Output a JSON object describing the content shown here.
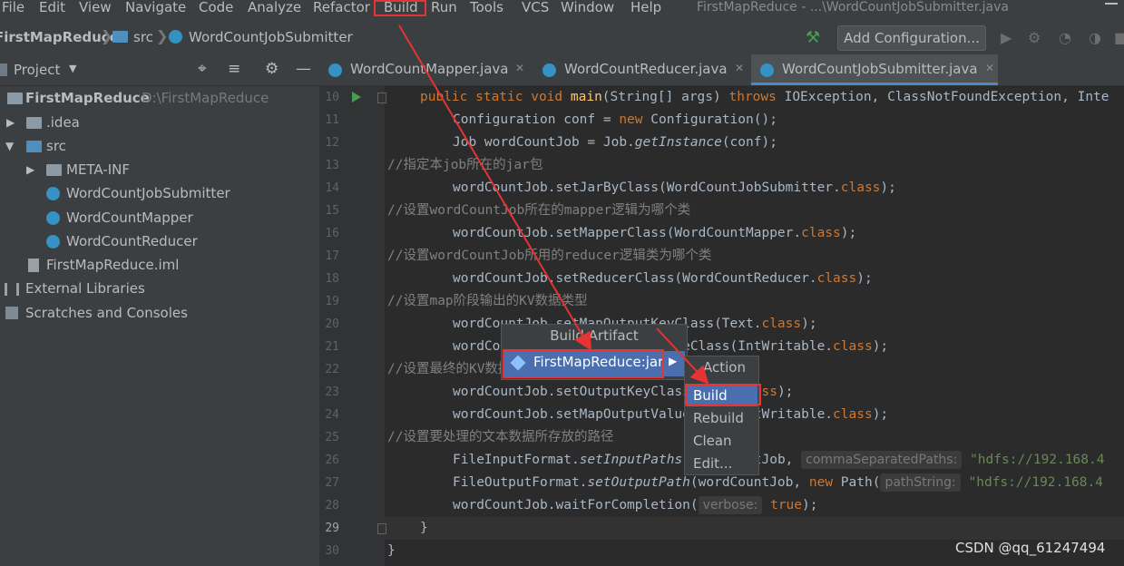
{
  "menubar": {
    "items": [
      "File",
      "Edit",
      "View",
      "Navigate",
      "Code",
      "Analyze",
      "Refactor",
      "Build",
      "Run",
      "Tools",
      "VCS",
      "Window",
      "Help"
    ],
    "window_title": "FirstMapReduce - ...\\WordCountJobSubmitter.java"
  },
  "breadcrumb": {
    "project": "FirstMapReduce",
    "folder": "src",
    "file": "WordCountJobSubmitter"
  },
  "toolbar": {
    "run_config_label": "Add Configuration..."
  },
  "project_panel": {
    "title": "Project",
    "tree": [
      {
        "label": "FirstMapReduce",
        "path": "D:\\FirstMapReduce"
      },
      {
        "label": ".idea"
      },
      {
        "label": "src"
      },
      {
        "label": "META-INF"
      },
      {
        "label": "WordCountJobSubmitter"
      },
      {
        "label": "WordCountMapper"
      },
      {
        "label": "WordCountReducer"
      },
      {
        "label": "FirstMapReduce.iml"
      },
      {
        "label": "External Libraries"
      },
      {
        "label": "Scratches and Consoles"
      }
    ]
  },
  "tabs": [
    {
      "label": "WordCountMapper.java"
    },
    {
      "label": "WordCountReducer.java"
    },
    {
      "label": "WordCountJobSubmitter.java"
    }
  ],
  "editor": {
    "line_numbers": [
      "10",
      "11",
      "12",
      "13",
      "14",
      "15",
      "16",
      "17",
      "18",
      "19",
      "20",
      "21",
      "22",
      "23",
      "24",
      "25",
      "26",
      "27",
      "28",
      "29",
      "30"
    ],
    "lines": {
      "l10": {
        "kw1": "public static void ",
        "fn": "main",
        "mid": "(String[] args) ",
        "kw2": "throws ",
        "rest": "IOException, ClassNotFoundException, Inte"
      },
      "l11": {
        "a": "Configuration conf = ",
        "kw": "new ",
        "b": "Configuration();"
      },
      "l12": {
        "a": "Job wordCountJob = Job.",
        "it": "getInstance",
        "b": "(conf);"
      },
      "l13": "//指定本job所在的jar包",
      "l14": {
        "a": "wordCountJob.setJarByClass(WordCountJobSubmitter.",
        "kw": "class",
        "b": ");"
      },
      "l15": "//设置wordCountJob所在的mapper逻辑为哪个类",
      "l16": {
        "a": "wordCountJob.setMapperClass(WordCountMapper.",
        "kw": "class",
        "b": ");"
      },
      "l17": "//设置wordCountJob所用的reducer逻辑类为哪个类",
      "l18": {
        "a": "wordCountJob.setReducerClass(WordCountReducer.",
        "kw": "class",
        "b": ");"
      },
      "l19": "//设置map阶段输出的KV数据类型",
      "l20": {
        "a": "wordCountJob.setMapOutputKeyClass(Text.",
        "kw": "class",
        "b": ");"
      },
      "l21": {
        "a": "wordCountJob.setMapOutputValueClass(IntWritable.",
        "kw": "class",
        "b": ");"
      },
      "l22": "//设置最终的KV数据类型",
      "l23": {
        "a": "wordCountJob.setOutputKeyClass(Text.",
        "kw": "class",
        "b": ");"
      },
      "l24": {
        "a": "wordCountJob.setMapOutputValueClass(IntWritable.",
        "kw": "class",
        "b": ");"
      },
      "l25": "//设置要处理的文本数据所存放的路径",
      "l26": {
        "a": "FileInputFormat.",
        "it": "setInputPaths",
        "b": "(wordCountJob, ",
        "hint": "commaSeparatedPaths:",
        "str": "\"hdfs://192.168.4"
      },
      "l27": {
        "a": "FileOutputFormat.",
        "it": "setOutputPath",
        "b": "(wordCountJob, ",
        "kw": "new ",
        "c": "Path(",
        "hint": "pathString:",
        "str": "\"hdfs://192.168.4"
      },
      "l28": {
        "a": "wordCountJob.waitForCompletion(",
        "hint": "verbose:",
        "kw": "true",
        "b": ");"
      },
      "l29": "}",
      "l30": "}"
    }
  },
  "build_artifact_popup": {
    "title": "Build Artifact",
    "selected": "FirstMapReduce:jar"
  },
  "action_popup": {
    "title": "Action",
    "items": [
      "Build",
      "Rebuild",
      "Clean",
      "Edit..."
    ]
  },
  "watermark": "CSDN @qq_61247494"
}
